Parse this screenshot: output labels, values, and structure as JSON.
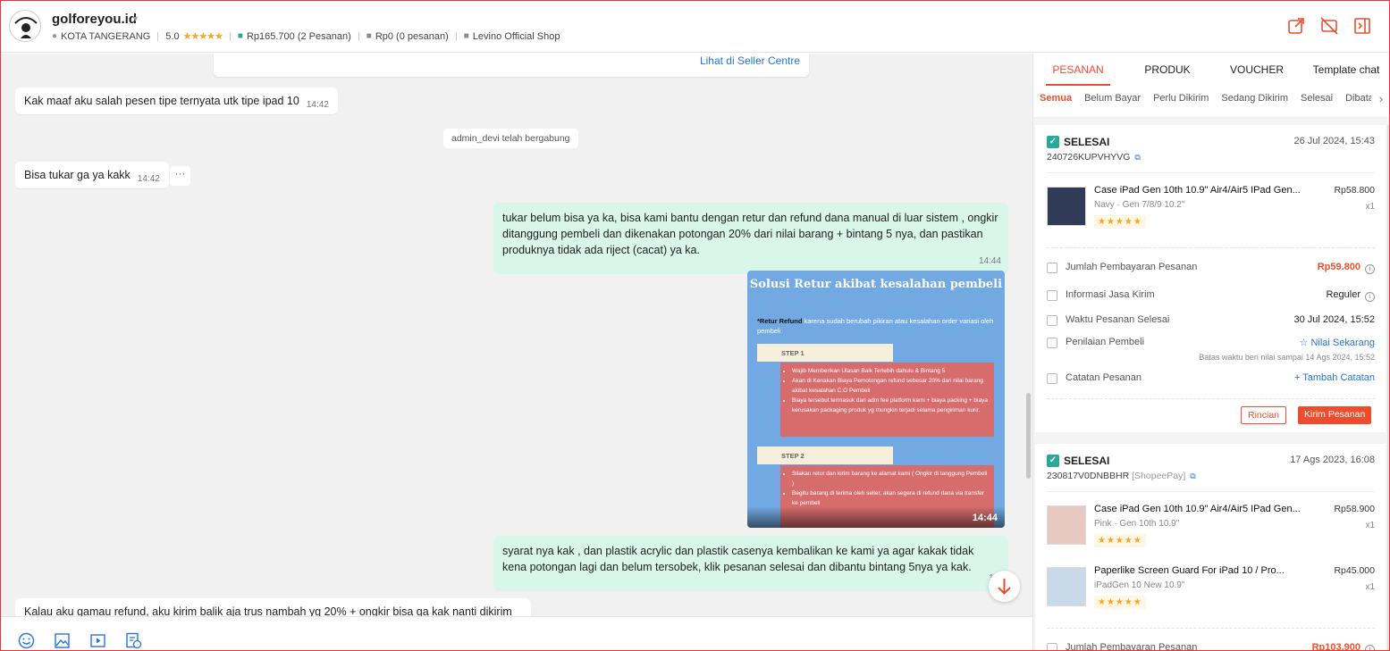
{
  "shop": {
    "name": "golforeyou.id",
    "location": "KOTA TANGERANG",
    "rating": "5.0",
    "rating_stars": "★★★★★",
    "orders_summary": "Rp165.700 (2 Pesanan)",
    "unpaid_summary": "Rp0 (0 pesanan)",
    "store_label": "Levino Official Shop"
  },
  "header_icons": [
    "share-icon",
    "block-chat-icon",
    "collapse-panel-icon"
  ],
  "chat": {
    "seller_centre_link": "Lihat di Seller Centre",
    "messages": [
      {
        "text": "Kak maaf aku salah pesen tipe ternyata utk tipe ipad 10",
        "time": "14:42"
      },
      {
        "system": "admin_devi telah bergabung"
      },
      {
        "text": "Bisa tukar ga ya kakk",
        "time": "14:42"
      },
      {
        "text": "tukar belum bisa ya ka, bisa kami bantu dengan retur dan refund dana manual di luar sistem , ongkir ditanggung pembeli dan dikenakan potongan 20% dari nilai barang + bintang 5 nya, dan pastikan produknya tidak ada riject (cacat) ya ka.",
        "time": "14:44"
      },
      {
        "image_time": "14:44"
      },
      {
        "text": " syarat nya kak , dan plastik acrylic dan plastik casenya kembalikan ke kami ya agar kakak tidak kena potongan lagi dan belum tersobek, klik pesanan selesai dan dibantu bintang 5nya ya kak.",
        "time": "14:"
      },
      {
        "text": "Kalau aku gamau refund, aku kirim balik aja trus nambah yg 20% + ongkir bisa ga kak nanti dikirim"
      }
    ],
    "more_label": "···",
    "image": {
      "title": "Solusi Retur akibat kesalahan pembeli",
      "lead_bold": "*Retur Refund",
      "lead_rest": " karena sudah berubah pikiran atau kesalahan order variasi oleh pembeli",
      "step1_label": "STEP 1",
      "step1_items": [
        "Wajib Memberikan Ulasan Baik Terlebih dahulu & Bintang 5",
        "Akan di Kenakan Biaya Pemotongan refund sebesar 20% dari nilai barang akibat kesalahan C.O Pembeli",
        "Biaya tersebut termasuk dari adm fee platform kami + biaya packing + biaya kerusakan packaging produk yg mungkin terjadi selama pengiriman kurir."
      ],
      "step2_label": "STEP 2",
      "step2_items": [
        "Silakan retur dan kirim barang ke alamat kami ( Ongkir di tanggung Pembeli )",
        "Begitu barang di terima oleh seller, akan segera di refund dana via transfer ke pembeli"
      ]
    },
    "input_tools": [
      "emoji-icon",
      "image-icon",
      "video-icon",
      "product-icon"
    ]
  },
  "panel": {
    "tabs": [
      "PESANAN",
      "PRODUK",
      "VOUCHER",
      "Template chat"
    ],
    "subtabs": [
      "Semua",
      "Belum Bayar",
      "Perlu Dikirim",
      "Sedang Dikirim",
      "Selesai",
      "Dibata"
    ],
    "subtab_arrow": "›",
    "orders": [
      {
        "status": "SELESAI",
        "date": "26 Jul 2024, 15:43",
        "id": "240726KUPVHYVG",
        "payment": "",
        "products": [
          {
            "name": "Case iPad Gen 10th 10.9\" Air4/Air5 IPad Gen...",
            "variant": "Navy · Gen 7/8/9 10.2\"",
            "price": "Rp58.800",
            "qty": "x1",
            "stars": "★★★★★"
          }
        ],
        "total_label": "Jumlah Pembayaran Pesanan",
        "total": "Rp59.800",
        "shipping_label": "Informasi Jasa Kirim",
        "shipping": "Reguler",
        "done_label": "Waktu Pesanan Selesai",
        "done": "30 Jul 2024, 15:52",
        "review_label": "Penilaian Pembeli",
        "review_action": "☆ Nilai Sekarang",
        "review_note": "Batas waktu beri nilai sampai 14 Ags 2024, 15:52",
        "note_label": "Catatan Pesanan",
        "note_action": "+ Tambah Catatan",
        "btn_detail": "Rincian",
        "btn_send": "Kirim Pesanan"
      },
      {
        "status": "SELESAI",
        "date": "17 Ags 2023, 16:08",
        "id": "230817V0DNBBHR",
        "payment": "[ShopeePay]",
        "products": [
          {
            "name": "Case iPad Gen 10th 10.9\" Air4/Air5 IPad Gen...",
            "variant": "Pink · Gen 10th 10.9\"",
            "price": "Rp58.900",
            "qty": "x1",
            "stars": "★★★★★"
          },
          {
            "name": "Paperlike Screen Guard For iPad 10 / Pro...",
            "variant": "iPadGen 10 New 10.9\"",
            "price": "Rp45.000",
            "qty": "x1",
            "stars": "★★★★★"
          }
        ],
        "total_label": "Jumlah Pembayaran Pesanan",
        "total": "Rp103.900"
      }
    ]
  },
  "colors": {
    "accent": "#ee4d2d",
    "bubble_out": "#d9f6ea",
    "link": "#2673dd",
    "chat_bg": "#f1f1f1"
  }
}
